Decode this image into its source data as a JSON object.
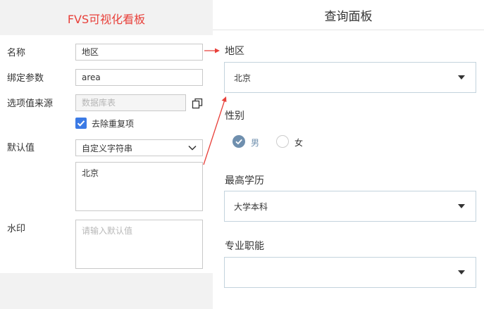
{
  "config": {
    "title": "FVS可视化看板",
    "labels": {
      "name": "名称",
      "bind_param": "绑定参数",
      "option_source": "选项值来源",
      "default_value": "默认值",
      "watermark": "水印"
    },
    "name_value": "地区",
    "bind_param_value": "area",
    "option_source_placeholder": "数据库表",
    "dedupe_label": "去除重复项",
    "dedupe_checked": true,
    "default_type_selected": "自定义字符串",
    "default_value_text": "北京",
    "watermark_placeholder": "请输入默认值"
  },
  "preview": {
    "title": "查询面板",
    "fields": [
      {
        "label": "地区",
        "value": "北京"
      },
      {
        "label": "性别"
      },
      {
        "label": "最高学历",
        "value": "大学本科"
      },
      {
        "label": "专业职能",
        "value": ""
      }
    ],
    "gender_options": [
      "男",
      "女"
    ],
    "gender_selected": "男"
  },
  "colors": {
    "accent_red": "#e8403a",
    "checkbox_blue": "#3b7ae5",
    "radio_checked": "#6f8fae"
  }
}
